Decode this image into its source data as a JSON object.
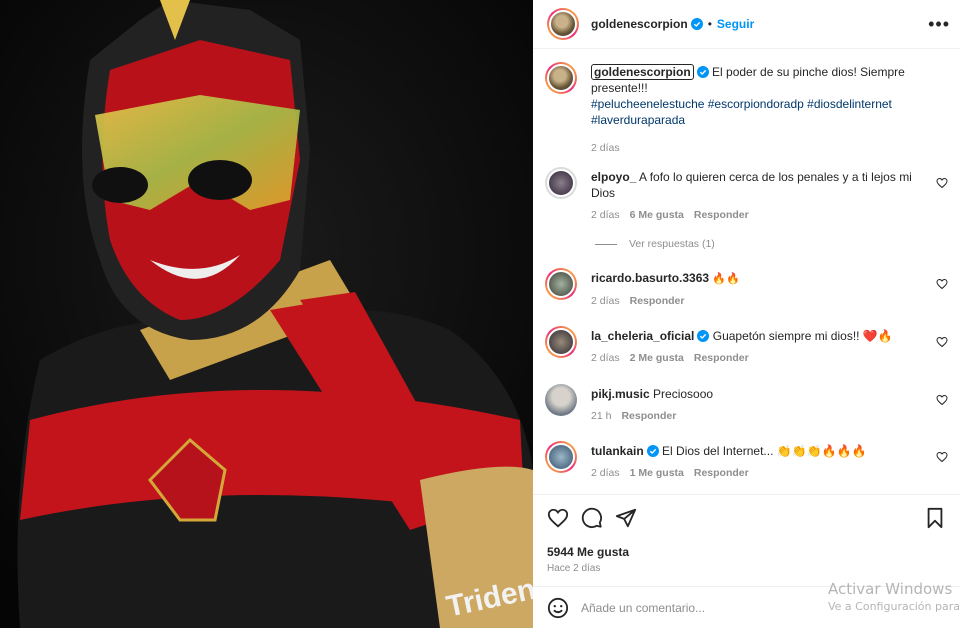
{
  "post": {
    "author": "goldenescorpion",
    "follow_label": "Seguir",
    "dot": "•",
    "caption_text": "El poder de su pinche dios! Siempre presente!!!",
    "hashtags": "#peluche​enelestuche #escorpiondoradp #diosdelinternet #laverduraparada",
    "caption_time": "2 días",
    "likes": "5944 Me gusta",
    "posted_ago": "Hace 2 días",
    "image_alt": "luchador-mask-photo",
    "brand_text": "Trident"
  },
  "comments": [
    {
      "user": "elpoyo_",
      "text": "A fofo lo quieren cerca de los penales y a ti lejos mi Dios",
      "time": "2 días",
      "likes": "6 Me gusta",
      "reply": "Responder",
      "view_replies": "Ver respuestas (1)"
    },
    {
      "user": "ricardo.basurto.3363",
      "text": "🔥🔥",
      "time": "2 días",
      "reply": "Responder"
    },
    {
      "user": "la_cheleria_oficial",
      "text": "Guapetón siempre mi dios!! ❤️🔥",
      "time": "2 días",
      "likes": "2 Me gusta",
      "reply": "Responder"
    },
    {
      "user": "pikj.music",
      "text": "Preciosooo",
      "time": "21 h",
      "reply": "Responder"
    },
    {
      "user": "tulankain",
      "text": "El Dios del Internet... 👏👏👏🔥🔥🔥",
      "time": "2 días",
      "likes": "1 Me gusta",
      "reply": "Responder"
    }
  ],
  "composer": {
    "placeholder": "Añade un comentario..."
  },
  "watermark": {
    "line1": "Activar Windows",
    "line2": "Ve a Configuración para"
  },
  "colors": {
    "accent": "#0095f6",
    "hashtag": "#00376b",
    "verified": "#0095f6",
    "muted": "#8e8e8e"
  }
}
